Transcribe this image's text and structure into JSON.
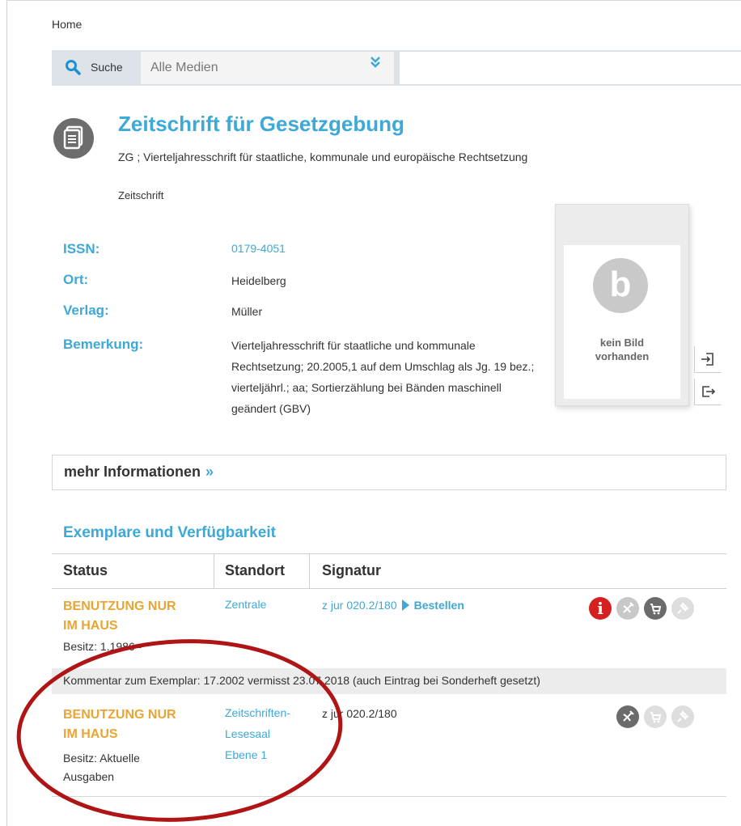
{
  "breadcrumb": {
    "home": "Home"
  },
  "search": {
    "label": "Suche",
    "scope": "Alle Medien",
    "input_value": ""
  },
  "record": {
    "title": "Zeitschrift für Gesetzgebung",
    "subtitle": "ZG ; Vierteljahresschrift für staatliche, kommunale und europäische Rechtsetzung",
    "media_type": "Zeitschrift",
    "fields": {
      "issn_label": "ISSN:",
      "issn_value": "0179-4051",
      "place_label": "Ort:",
      "place_value": "Heidelberg",
      "publisher_label": "Verlag:",
      "publisher_value": "Müller",
      "remark_label": "Bemerkung:",
      "remark_value": "Vierteljahresschrift für staatliche und kommunale Rechtsetzung; 20.2005,1 auf dem Umschlag als Jg. 19 bez.; vierteljährl.; aa; Sortierzählung bei Bänden maschinell geändert (GBV)"
    },
    "cover": {
      "letter": "b",
      "line1": "kein Bild",
      "line2": "vorhanden"
    }
  },
  "more_info": {
    "label": "mehr Informationen",
    "chevron": "»"
  },
  "holdings": {
    "heading": "Exemplare und Verfügbarkeit",
    "columns": {
      "status": "Status",
      "location": "Standort",
      "signature": "Signatur"
    },
    "rows": [
      {
        "status_line1": "BENUTZUNG NUR",
        "status_line2": "IM HAUS",
        "possession": "Besitz: 1.1986 -",
        "location_line1": "Zentrale",
        "signature": "z jur 020.2/180",
        "order_label": "Bestellen"
      },
      {
        "status_line1": "BENUTZUNG NUR",
        "status_line2": "IM HAUS",
        "possession_line1": "Besitz: Aktuelle",
        "possession_line2": "Ausgaben",
        "location_line1": "Zeitschriften-",
        "location_line2": "Lesesaal",
        "location_line3": "Ebene 1",
        "signature": "z jur 020.2/180"
      }
    ],
    "comment": "Kommentar zum Exemplar: 17.2002 vermisst 23.07.2018 (auch Eintrag bei Sonderheft gesetzt)"
  },
  "icons": {
    "info": "i",
    "colors": {
      "accent": "#3ea8d6",
      "status": "#e8a534",
      "alert": "#d62020",
      "annotation": "#b01515"
    }
  }
}
